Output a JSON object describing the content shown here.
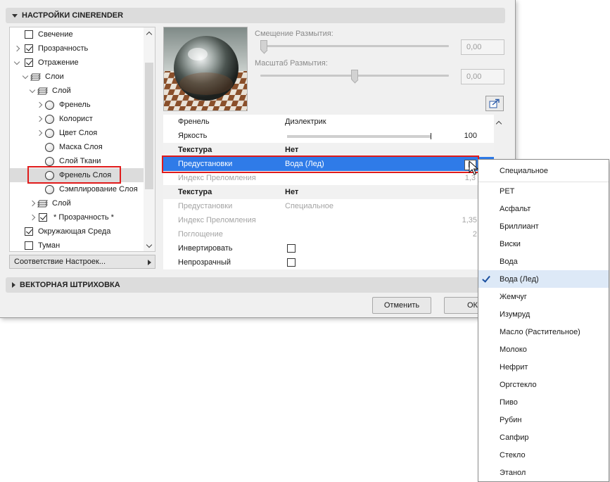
{
  "sections": {
    "cinerender": "НАСТРОЙКИ CINERENDER",
    "vector": "ВЕКТОРНАЯ ШТРИХОВКА"
  },
  "tree": [
    {
      "label": "Свечение"
    },
    {
      "label": "Прозрачность"
    },
    {
      "label": "Отражение"
    },
    {
      "label": "Слои"
    },
    {
      "label": "Слой"
    },
    {
      "label": "Френель"
    },
    {
      "label": "Колорист"
    },
    {
      "label": "Цвет Слоя"
    },
    {
      "label": "Маска Слоя"
    },
    {
      "label": "Слой Ткани"
    },
    {
      "label": "Френель Слоя"
    },
    {
      "label": "Сэмплирование Слоя"
    },
    {
      "label": "Слой"
    },
    {
      "label": "* Прозрачность *"
    },
    {
      "label": "Окружающая Среда"
    },
    {
      "label": "Туман"
    }
  ],
  "match_settings": "Соответствие Настроек...",
  "blur_offset": {
    "label": "Смещение Размытия:",
    "value": "0,00",
    "level": 0.0
  },
  "blur_scale": {
    "label": "Масштаб Размытия:",
    "value": "0,00",
    "level": 0.5
  },
  "props": {
    "fresnel": {
      "k": "Френель",
      "v": "Диэлектрик"
    },
    "brightness": {
      "k": "Яркость",
      "n": "100",
      "level": 1.0
    },
    "texture1": {
      "k": "Текстура",
      "v": "Нет"
    },
    "presets1": {
      "k": "Предустановки",
      "v": "Вода (Лед)"
    },
    "ior1": {
      "k": "Индекс Преломления",
      "n": "1,3"
    },
    "texture2": {
      "k": "Текстура",
      "v": "Нет"
    },
    "presets2": {
      "k": "Предустановки",
      "v": "Специальное"
    },
    "ior2": {
      "k": "Индекс Преломления",
      "n": "1,35"
    },
    "absorption": {
      "k": "Поглощение",
      "n": "2"
    },
    "invert": {
      "k": "Инвертировать"
    },
    "opaque": {
      "k": "Непрозрачный"
    }
  },
  "buttons": {
    "cancel": "Отменить",
    "ok": "ОК"
  },
  "menu": {
    "items": [
      "Специальное",
      "PET",
      "Асфальт",
      "Бриллиант",
      "Виски",
      "Вода",
      "Вода (Лед)",
      "Жемчуг",
      "Изумруд",
      "Масло (Растительное)",
      "Молоко",
      "Нефрит",
      "Оргстекло",
      "Пиво",
      "Рубин",
      "Сапфир",
      "Стекло",
      "Этанол"
    ],
    "selected": "Вода (Лед)"
  },
  "colors": {
    "selection": "#2f7be8",
    "highlight_border": "#e01b1b",
    "menu_check": "#1a4fa0"
  },
  "icons": [
    "chevron-right-icon",
    "chevron-down-icon",
    "checkbox-icon",
    "layers-icon",
    "material-sphere-icon",
    "popup-arrow-icon",
    "export-icon",
    "checkmark-icon",
    "mouse-cursor-icon"
  ]
}
